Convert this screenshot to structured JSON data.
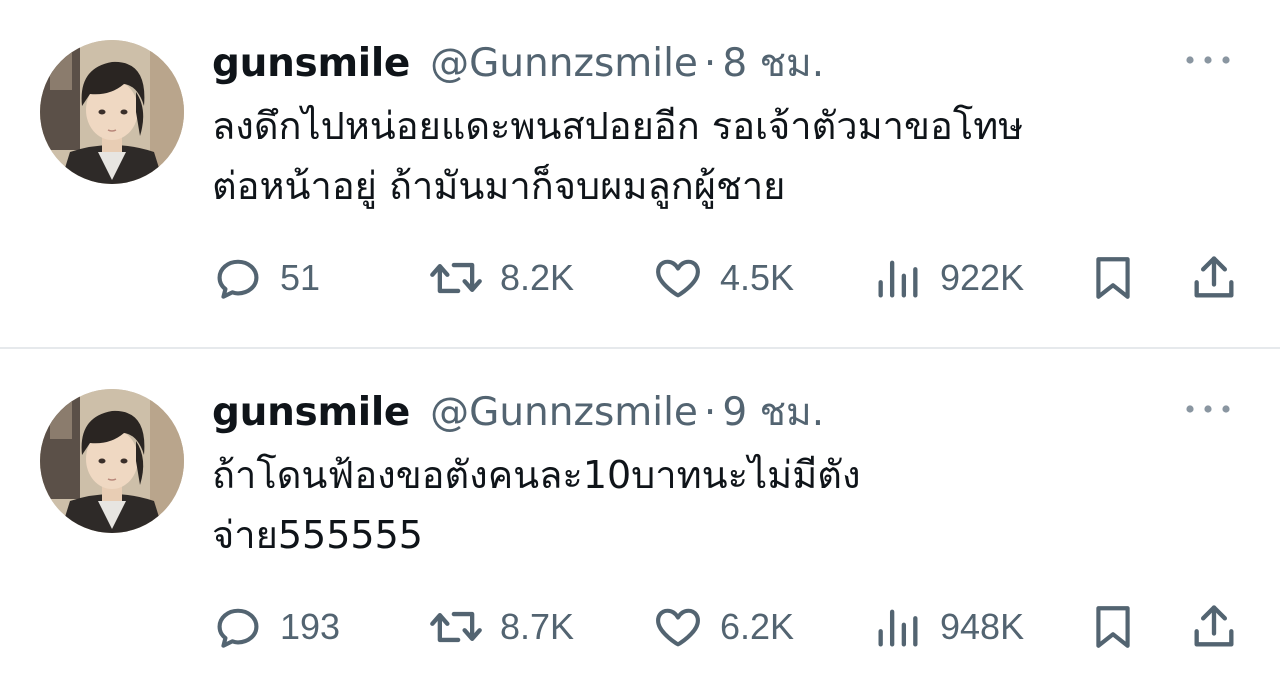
{
  "tweets": [
    {
      "display_name": "gunsmile",
      "handle": "@Gunnzsmile",
      "separator": "·",
      "time": "8 ชม.",
      "text_lines": [
        "ลงดึกไปหน่อยแดะพนสปอยอีก รอเจ้าตัวมาขอโทษ",
        "ต่อหน้าอยู่ ถ้ามันมาก็จบผมลูกผู้ชาย"
      ],
      "replies": "51",
      "retweets": "8.2K",
      "likes": "4.5K",
      "views": "922K"
    },
    {
      "display_name": "gunsmile",
      "handle": "@Gunnzsmile",
      "separator": "·",
      "time": "9 ชม.",
      "text_lines": [
        "ถ้าโดนฟ้องขอตังคนละ10บาทนะไม่มีตัง",
        "จ่าย555555"
      ],
      "replies": "193",
      "retweets": "8.7K",
      "likes": "6.2K",
      "views": "948K"
    }
  ],
  "icons": {
    "reply": "reply-icon",
    "retweet": "retweet-icon",
    "like": "like-icon",
    "views": "views-icon",
    "bookmark": "bookmark-icon",
    "share": "share-icon",
    "more": "more-icon"
  },
  "colors": {
    "text": "#0f1419",
    "secondary": "#536471",
    "divider": "#e6e9ec",
    "background": "#ffffff"
  }
}
